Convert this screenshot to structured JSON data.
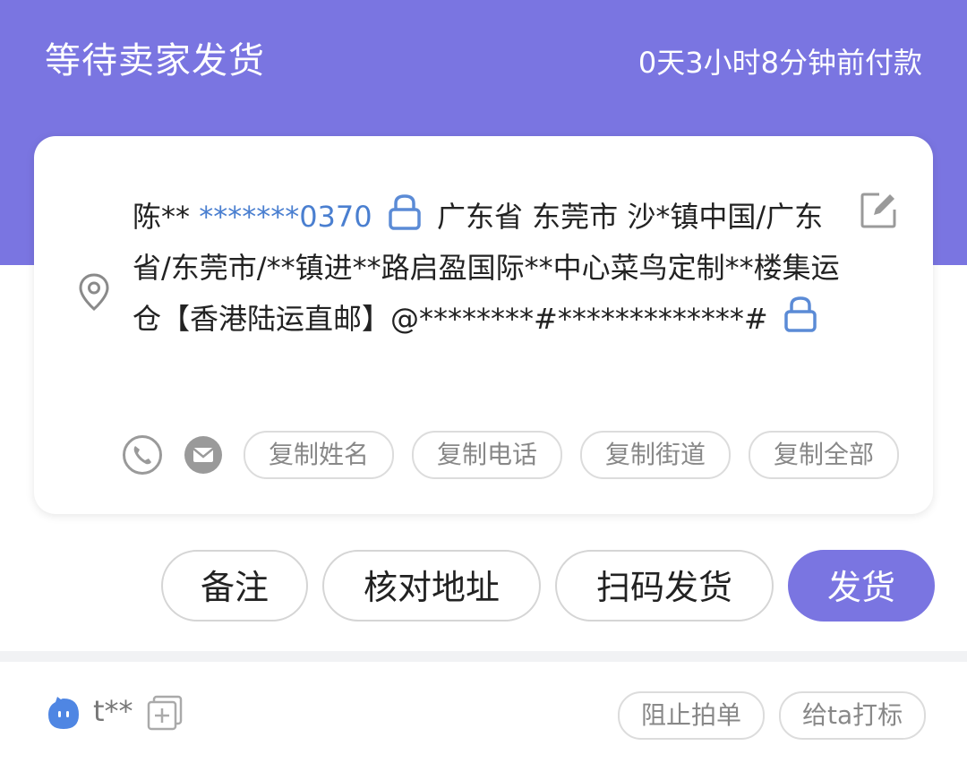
{
  "header": {
    "status_title": "等待卖家发货",
    "payment_time": "0天3小时8分钟前付款"
  },
  "address_card": {
    "recipient_name": "陈**",
    "phone": "*******0370",
    "address_text": "广东省 东莞市 沙*镇中国/广东省/东莞市/**镇进**路启盈国际**中心菜鸟定制**楼集运仓【香港陆运直邮】@********#*************#",
    "icons": {
      "location": "location-pin-icon",
      "edit": "edit-icon",
      "lock": "lock-icon",
      "phone": "phone-icon",
      "message": "message-icon"
    },
    "copy_buttons": {
      "copy_name": "复制姓名",
      "copy_phone": "复制电话",
      "copy_street": "复制街道",
      "copy_all": "复制全部"
    }
  },
  "order_actions": {
    "remark": "备注",
    "verify_address": "核对地址",
    "scan_ship": "扫码发货",
    "ship": "发货"
  },
  "buyer": {
    "name": "t**",
    "avatar_icon": "buyer-avatar-icon",
    "add_icon": "add-icon",
    "block_order": "阻止拍单",
    "tag_buyer": "给ta打标"
  },
  "colors": {
    "primary": "#7a75e1",
    "link_blue": "#4a7fd0",
    "divider": "#f1f2f4"
  }
}
